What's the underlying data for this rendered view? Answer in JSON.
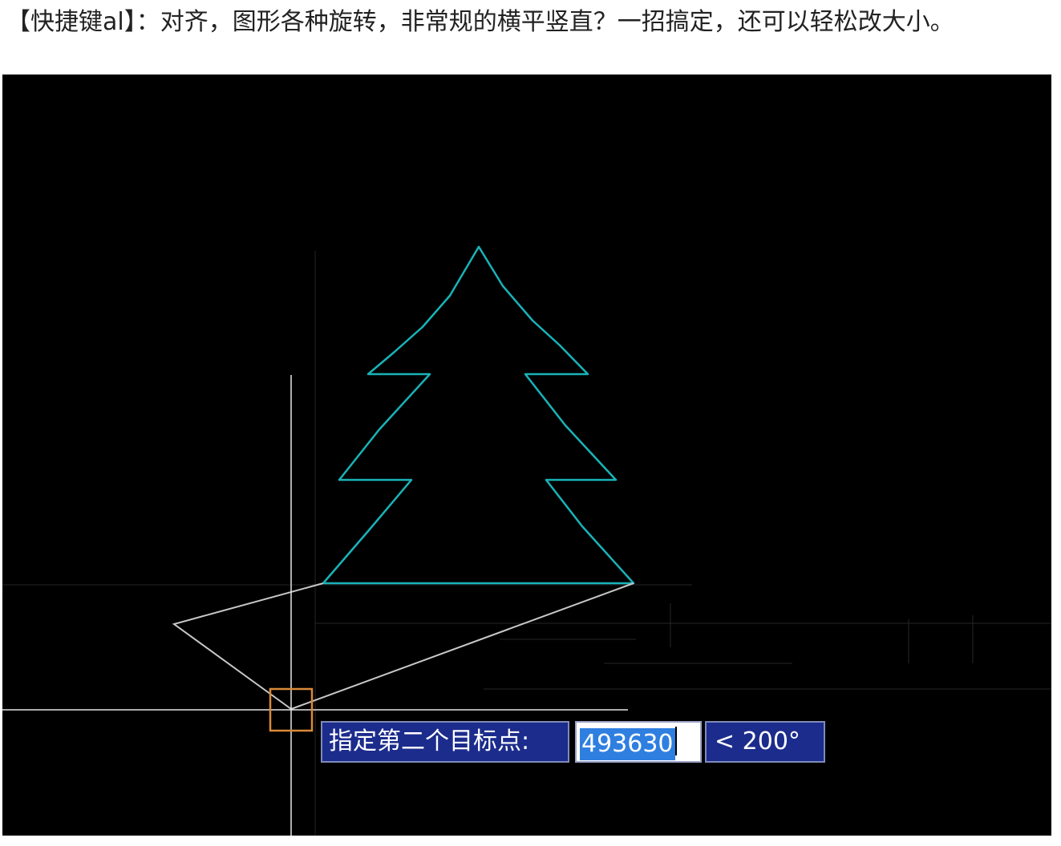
{
  "caption": {
    "text": "【快捷键al】：对齐，图形各种旋转，非常规的横平竖直？一招搞定，还可以轻松改大小。"
  },
  "cad": {
    "colors": {
      "background": "#000000",
      "tree": "#19b3b8",
      "rubber_band": "#c8c8c8",
      "crosshair": "#e6e6e6",
      "pickbox": "#d98a3a",
      "input_bg": "#1c2c8c",
      "selection": "#2f7fe0"
    },
    "dynamic_input": {
      "prompt": "指定第二个目标点:",
      "value": "493630",
      "angle": "< 200°"
    }
  }
}
